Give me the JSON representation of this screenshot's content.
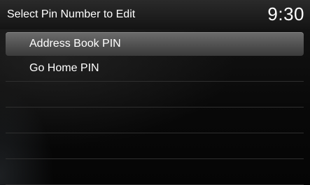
{
  "header": {
    "title": "Select Pin Number to Edit",
    "time": "9:30"
  },
  "list": {
    "items": [
      {
        "label": "Address Book PIN",
        "selected": true
      },
      {
        "label": "Go Home PIN",
        "selected": false
      }
    ]
  },
  "colors": {
    "background": "#000000",
    "header": "#1e1e1e",
    "selection": "#555555",
    "text": "#ffffff",
    "divider": "#2f2f2f"
  }
}
